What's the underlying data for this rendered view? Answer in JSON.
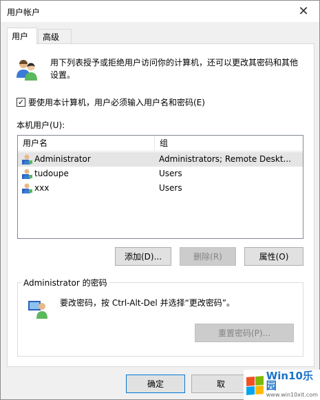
{
  "window": {
    "title": "用户帐户",
    "close_glyph": "✕"
  },
  "tabs": [
    {
      "label": "用户"
    },
    {
      "label": "高级"
    }
  ],
  "intro": {
    "text": "用下列表授予或拒绝用户访问你的计算机，还可以更改其密码和其他设置。"
  },
  "require_login": {
    "checked_glyph": "✓",
    "label": "要使用本计算机，用户必须输入用户名和密码(E)"
  },
  "users_section": {
    "label": "本机用户(U):",
    "columns": [
      "用户名",
      "组"
    ],
    "rows": [
      {
        "name": "Administrator",
        "group": "Administrators; Remote Deskt...",
        "selected": true
      },
      {
        "name": "tudoupe",
        "group": "Users",
        "selected": false
      },
      {
        "name": "xxx",
        "group": "Users",
        "selected": false
      }
    ]
  },
  "buttons": {
    "add": "添加(D)...",
    "remove": "删除(R)",
    "properties": "属性(O)"
  },
  "password_group": {
    "title": "Administrator 的密码",
    "text": "要改密码，按 Ctrl-Alt-Del 并选择“更改密码”。",
    "reset_button": "重置密码(P)..."
  },
  "footer": {
    "ok": "确定",
    "cancel": "取"
  },
  "watermark": {
    "brand": "Win10乐园",
    "url": "www.win10xit.com"
  },
  "icons": {
    "user": "user-icon",
    "users": "users-icon",
    "password": "user-key-icon"
  },
  "colors": {
    "accent": "#0078d7",
    "selected_row": "#e5e5e5"
  }
}
